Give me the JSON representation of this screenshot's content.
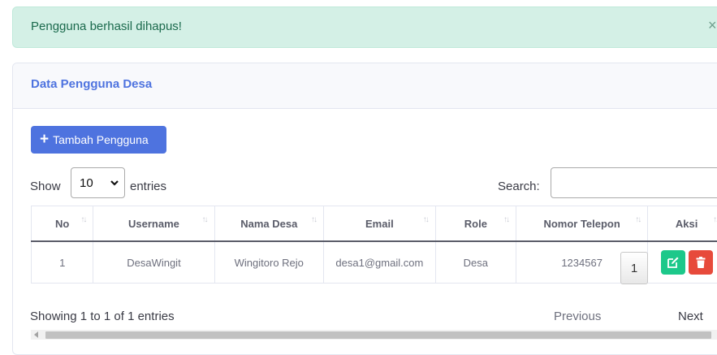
{
  "alert": {
    "message": "Pengguna berhasil dihapus!",
    "close": "×"
  },
  "card": {
    "title": "Data Pengguna Desa",
    "add_button": "Tambah Pengguna"
  },
  "length": {
    "show": "Show",
    "value": "10",
    "entries": "entries"
  },
  "search": {
    "label": "Search:",
    "value": "",
    "placeholder": ""
  },
  "table": {
    "columns": [
      "No",
      "Username",
      "Nama Desa",
      "Email",
      "Role",
      "Nomor Telepon",
      "Aksi"
    ],
    "rows": [
      [
        "1",
        "DesaWingit",
        "Wingitoro Rejo",
        "desa1@gmail.com",
        "Desa",
        "1234567"
      ]
    ]
  },
  "footer": {
    "info": "Showing 1 to 1 of 1 entries",
    "previous": "Previous",
    "current_page": "1",
    "next": "Next"
  },
  "colors": {
    "primary": "#4e73df",
    "success": "#1cc88a",
    "danger": "#e74a3b",
    "alert_bg": "#d4f0e6"
  },
  "icons": {
    "add": "plus-icon",
    "edit": "edit-icon",
    "delete": "trash-icon",
    "sort": "sort-icon",
    "select": "chevron-down-icon"
  }
}
